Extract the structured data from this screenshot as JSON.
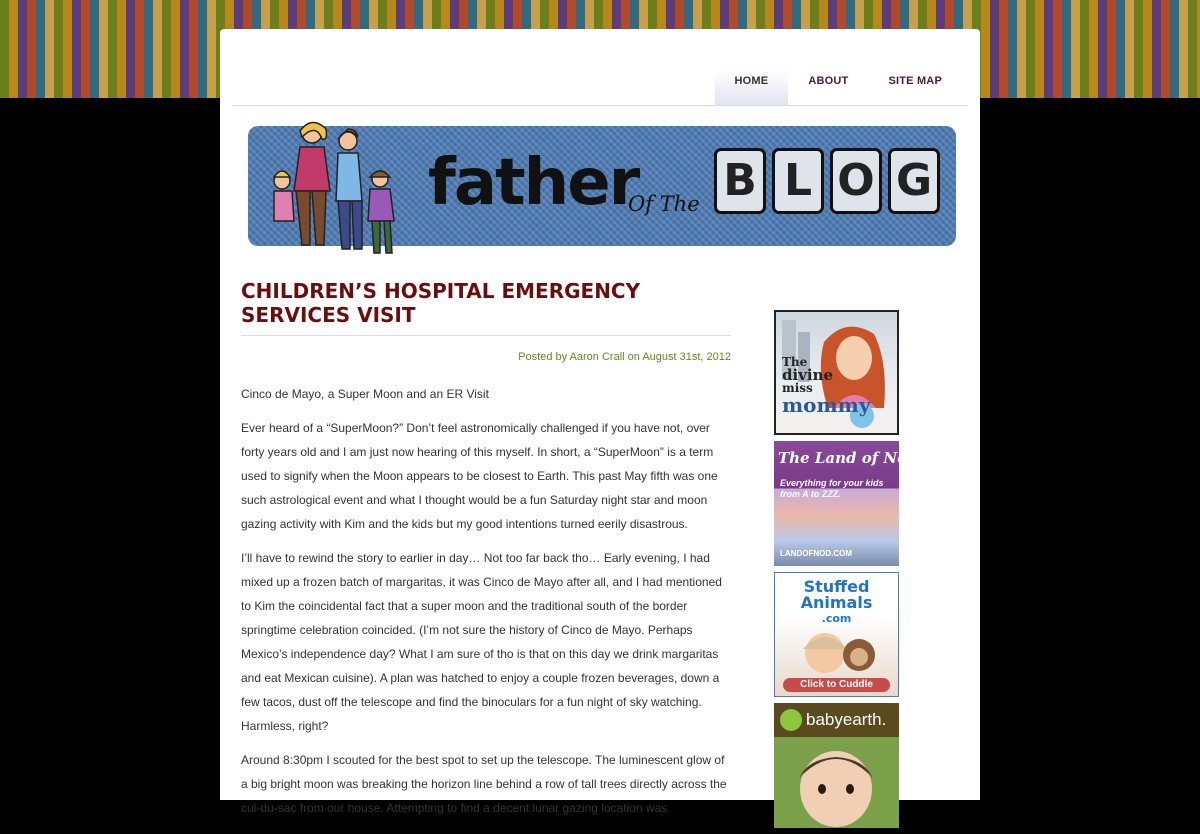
{
  "nav": {
    "home": "HOME",
    "about": "ABOUT",
    "sitemap": "SITE MAP"
  },
  "banner": {
    "title_father": "father",
    "title_of_the": "Of The",
    "title_blog": [
      "B",
      "L",
      "O",
      "G"
    ]
  },
  "post": {
    "title": "CHILDREN’S HOSPITAL EMERGENCY SERVICES VISIT",
    "meta": "Posted by Aaron Crall on August 31st, 2012",
    "paragraphs": [
      "Cinco de Mayo, a Super Moon and an ER Visit",
      "Ever heard of a “SuperMoon?” Don’t feel astronomically challenged if you have not, over forty years old and I am just now hearing of this myself. In short, a “SuperMoon” is a term used to signify when the Moon appears to be closest to Earth. This past May fifth was one such astrological event and what I thought would be a fun Saturday night star and moon gazing activity with Kim and the kids but my good intentions turned eerily disastrous.",
      "I’ll have to rewind the story to earlier in day… Not too far back tho… Early evening, I had mixed up a frozen batch of margaritas, it was Cinco de Mayo after all, and I had mentioned to Kim the coincidental fact that a super moon and the traditional south of the border springtime celebration coincided. (I’m not sure the history of Cinco de Mayo. Perhaps Mexico’s independence day? What I am sure of tho is that on this day we drink margaritas and eat Mexican cuisine). A plan was hatched to enjoy a couple frozen beverages, down a few tacos, dust off the telescope and find the binoculars for a fun night of sky watching. Harmless, right?",
      "Around 8:30pm I scouted for the best spot to set up the telescope. The luminescent glow of a big bright moon was breaking the horizon line behind a row of tall trees directly across the cul-du-sac from our house. Attempting to find a decent lunar gazing location was"
    ]
  },
  "ads": {
    "ad1": {
      "line1": "The",
      "line2": "divine",
      "line3": "miss",
      "line4": "mommy"
    },
    "ad2": {
      "title": "The Land of Nod",
      "tagline": "Everything for your kids from A to ZZZ.",
      "url": "LANDOFNOD.COM"
    },
    "ad3": {
      "line1": "Stuffed",
      "line2": "Animals",
      "line3": ".com",
      "button": "Click to Cuddle"
    },
    "ad4": {
      "brand": "babyearth."
    }
  }
}
